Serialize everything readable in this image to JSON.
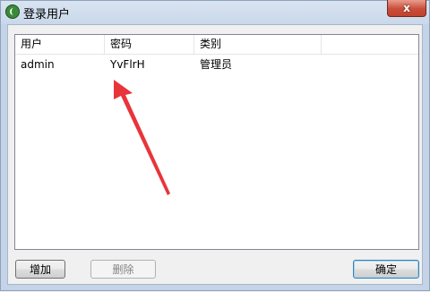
{
  "window": {
    "title": "登录用户",
    "close_label": "x"
  },
  "table": {
    "columns": [
      "用户",
      "密码",
      "类别"
    ],
    "rows": [
      {
        "user": "admin",
        "password": "YvFlrH",
        "role": "管理员"
      }
    ]
  },
  "buttons": {
    "add": "增加",
    "delete": "删除",
    "ok": "确定"
  },
  "annotation": {
    "arrow_color": "#e8353a"
  }
}
